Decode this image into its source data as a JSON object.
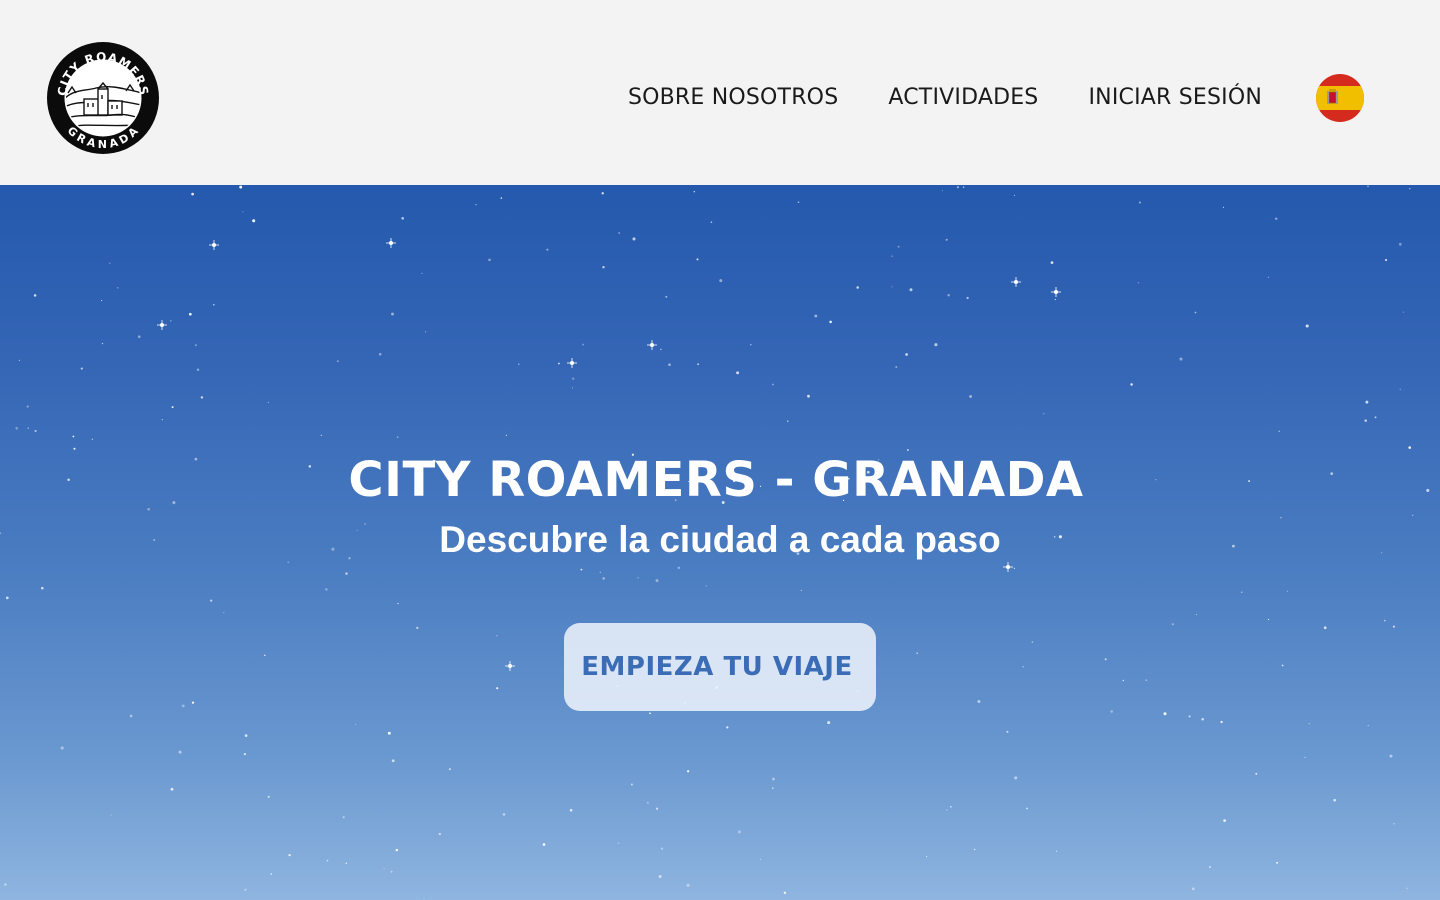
{
  "header": {
    "logo": {
      "top_text": "CITY ROAMERS",
      "bottom_text": "GRANADA"
    },
    "nav": [
      {
        "label": "SOBRE NOSOTROS"
      },
      {
        "label": "ACTIVIDADES"
      },
      {
        "label": "INICIAR SESIÓN"
      }
    ],
    "language_flag": "spain-flag-icon"
  },
  "hero": {
    "title": "CITY ROAMERS - GRANADA",
    "subtitle": "Descubre la ciudad a cada paso",
    "cta_label": "EMPIEZA TU VIAJE"
  },
  "colors": {
    "header_bg": "#f3f3f3",
    "hero_top": "#2459ad",
    "hero_bottom": "#8fb5e0",
    "cta_text": "#3b6cb6",
    "nav_text": "#1a1a1a"
  }
}
